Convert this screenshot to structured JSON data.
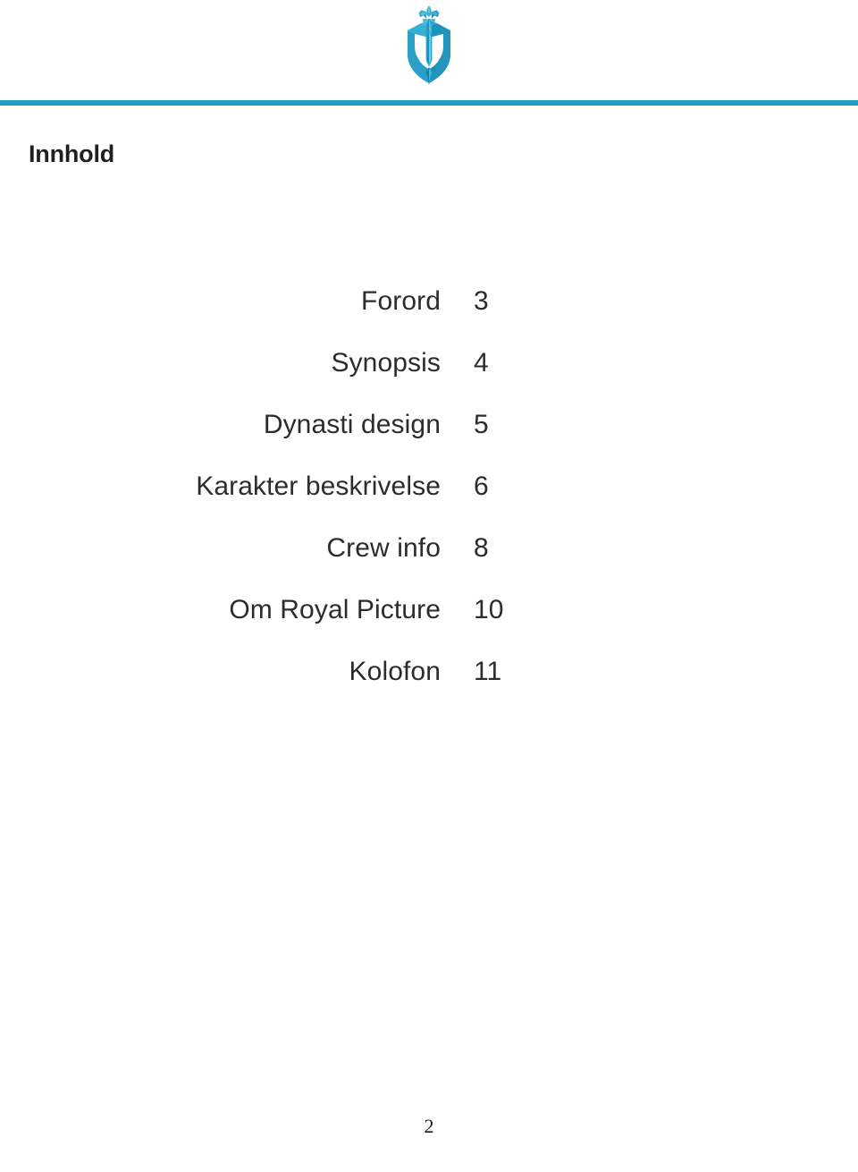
{
  "document": {
    "page_number": "2",
    "section_heading": "Innhold"
  },
  "header": {
    "logo_name": "royal-crown-emblem-icon",
    "rule_color": "#1f9cbf",
    "logo_colors": {
      "light": "#4ec3e0",
      "mid": "#29a8cc",
      "dark": "#1b86ad",
      "darkest": "#156f93"
    }
  },
  "toc": {
    "entries": [
      {
        "title": "Forord",
        "page": "3"
      },
      {
        "title": "Synopsis",
        "page": "4"
      },
      {
        "title": "Dynasti design",
        "page": "5"
      },
      {
        "title": "Karakter beskrivelse",
        "page": "6"
      },
      {
        "title": "Crew info",
        "page": "8"
      },
      {
        "title": "Om Royal Picture",
        "page": "10"
      },
      {
        "title": "Kolofon",
        "page": "11"
      }
    ]
  }
}
